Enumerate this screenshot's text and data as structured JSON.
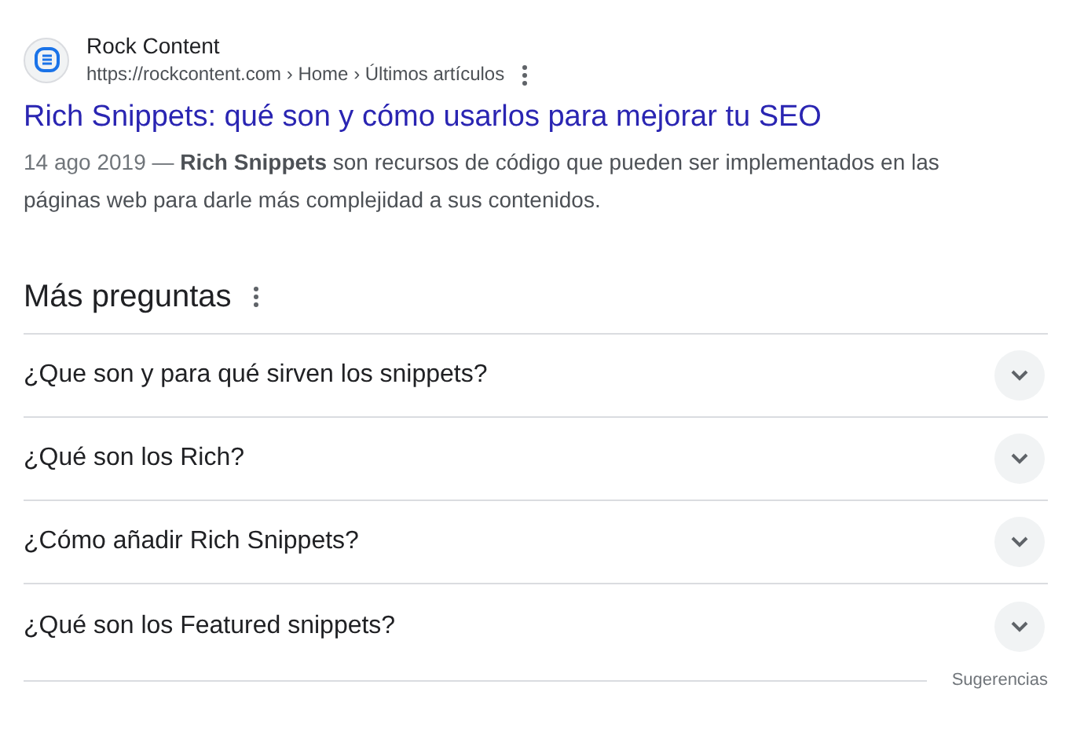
{
  "result": {
    "site_name": "Rock Content",
    "url": "https://rockcontent.com › Home › Últimos artículos",
    "title": "Rich Snippets: qué son y cómo usarlos para mejorar tu SEO",
    "date": "14 ago 2019 —",
    "snippet": "**Rich Snippets** son recursos de código que pueden ser implementados en las páginas web para darle más complejidad a sus contenidos."
  },
  "questions": {
    "heading": "Más preguntas",
    "items": [
      {
        "text": "¿Que son y para qué sirven los snippets?",
        "expanded": false
      },
      {
        "text": "¿Qué son los Rich?",
        "expanded": false
      },
      {
        "text": "¿Cómo añadir Rich Snippets?",
        "expanded": false
      },
      {
        "text": "¿Qué son los Featured snippets?",
        "expanded": false
      }
    ],
    "footer": "Sugerencias"
  }
}
